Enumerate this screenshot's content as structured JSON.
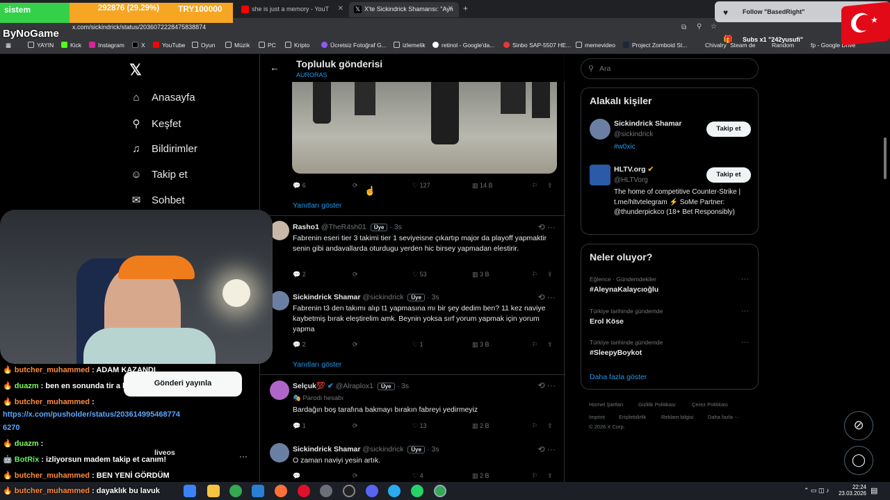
{
  "browser": {
    "tabs": [
      {
        "label": "she is just a memory - YouT"
      },
      {
        "label": "X'te Sickindrick Shamarısı: \"Ayn"
      }
    ],
    "url": "x.com/sickindrick/status/2036072228475838874",
    "bookmarks": [
      "YAYIN",
      "Kick",
      "Instagram",
      "X",
      "YouTube",
      "Oyun",
      "Müzik",
      "PC",
      "Kripto",
      "Ücretsiz Fotoğraf G...",
      "izlemelik",
      "retinol - Google'da...",
      "Sinbo SAP-5507 HE...",
      "memevideo",
      "Project Zomboid St...",
      "Chivalry",
      "Steam de",
      "Random",
      "fp - Google Drive"
    ]
  },
  "overlay": {
    "stat_label": "sistem",
    "stat_value": "292876 (29.29%)",
    "stat_currency": "TRY100000",
    "logo": "ByNoGame",
    "follow_alert": "Follow \"BasedRight\"",
    "subs_alert": "Subs x1 \"242yusufi\"",
    "repost_popup": "Gönderi yayınla"
  },
  "nav": {
    "items": [
      "Anasayfa",
      "Keşfet",
      "Bildirimler",
      "Takip et",
      "Sohbet"
    ]
  },
  "header": {
    "title": "Topluluk gönderisi",
    "subtitle": "AURORAS"
  },
  "first_tweet_actions": {
    "replies": "6",
    "likes": "127",
    "views": "14 B"
  },
  "show_replies": "Yanıtları göster",
  "tweets": [
    {
      "name": "Rasho1",
      "handle": "@TheR4sh01",
      "badge": "Üye",
      "time": "3s",
      "text": "Fabrenin eseri tier 3 takimi tier 1 seviyeisne çıkartıp major da playoff yapmaktir senin gibi andavallarda oturdugu yerden hic birsey yapmadan elestirir.",
      "replies": "2",
      "likes": "53",
      "views": "3 B"
    },
    {
      "name": "Sickindrick Shamar",
      "handle": "@sickindrick",
      "badge": "Üye",
      "time": "3s",
      "text": "Fabrenin t3 den takımı alıp t1 yapmasına mı bir şey dedim ben? 11 kez naviye kaybetmiş bırak eleştirelim amk. Beynin yoksa sırf yorum yapmak için yorum yapma",
      "replies": "2",
      "likes": "1",
      "views": "3 B"
    },
    {
      "name": "Selçuk💯",
      "handle": "@Alraplox1",
      "badge": "Üye",
      "time": "3s",
      "parody": "Parodi hesabı",
      "text": "Bardağın boş tarafına bakmayı bırakın fabreyi yedirmeyiz",
      "replies": "1",
      "likes": "13",
      "views": "2 B"
    },
    {
      "name": "Sickindrick Shamar",
      "handle": "@sickindrick",
      "badge": "Üye",
      "time": "3s",
      "text": "O zaman naviyi yesin artık.",
      "replies": "",
      "likes": "4",
      "views": "2 B"
    }
  ],
  "search": {
    "placeholder": "Ara"
  },
  "related": {
    "title": "Alakalı kişiler",
    "people": [
      {
        "name": "Sickindrick Shamar",
        "handle": "@sickindrick",
        "bio": "#w0xic",
        "button": "Takip et"
      },
      {
        "name": "HLTV.org",
        "handle": "@HLTVorg",
        "bio": "The home of competitive Counter-Strike | t.me/hltvtelegram ⚡ SoMe Partner: @thunderpickco (18+ Bet Responsibly)",
        "button": "Takip et"
      }
    ]
  },
  "trends": {
    "title": "Neler oluyor?",
    "items": [
      {
        "category": "Eğlence · Gündemdekiler",
        "name": "#AleynaKalaycıoğlu"
      },
      {
        "category": "Türkiye tarihinde gündemde",
        "name": "Erol Köse"
      },
      {
        "category": "Türkiye tarihinde gündemde",
        "name": "#SleepyBoykot"
      }
    ],
    "show_more": "Daha fazla göster"
  },
  "footer": {
    "links": [
      "Hizmet Şartları",
      "Gizlilik Politikası",
      "Çerez Politikası",
      "Imprint",
      "Erişilebilirlik",
      "Reklam bilgisi",
      "Daha fazla ···"
    ],
    "copyright": "© 2026 X Corp."
  },
  "chat": [
    {
      "user": "butcher_muhammed",
      "msg": ": ADAM KAZANDI"
    },
    {
      "user": "duazm",
      "msg": ": ben en sonunda tir a lpg takılırcam"
    },
    {
      "user": "butcher_muhammed",
      "msg": ":"
    },
    {
      "link": "https://x.com/pusholder/status/203614995468774"
    },
    {
      "link": "6270"
    },
    {
      "user": "duazm",
      "msg": ":"
    },
    {
      "user": "BotRix",
      "msg": ": izliyorsun madem takip et canım!"
    },
    {
      "user": "butcher_muhammed",
      "msg": ": BEN YENİ GÖRDÜM"
    },
    {
      "user": "butcher_muhammed",
      "msg": ": dayaklık bu lavuk"
    }
  ],
  "liveos": "liveos",
  "clock": {
    "time": "22:24",
    "date": "23.03.2026"
  },
  "colors": {
    "accent": "#1d9bf0",
    "bg": "#000000",
    "border": "#2f3336"
  }
}
